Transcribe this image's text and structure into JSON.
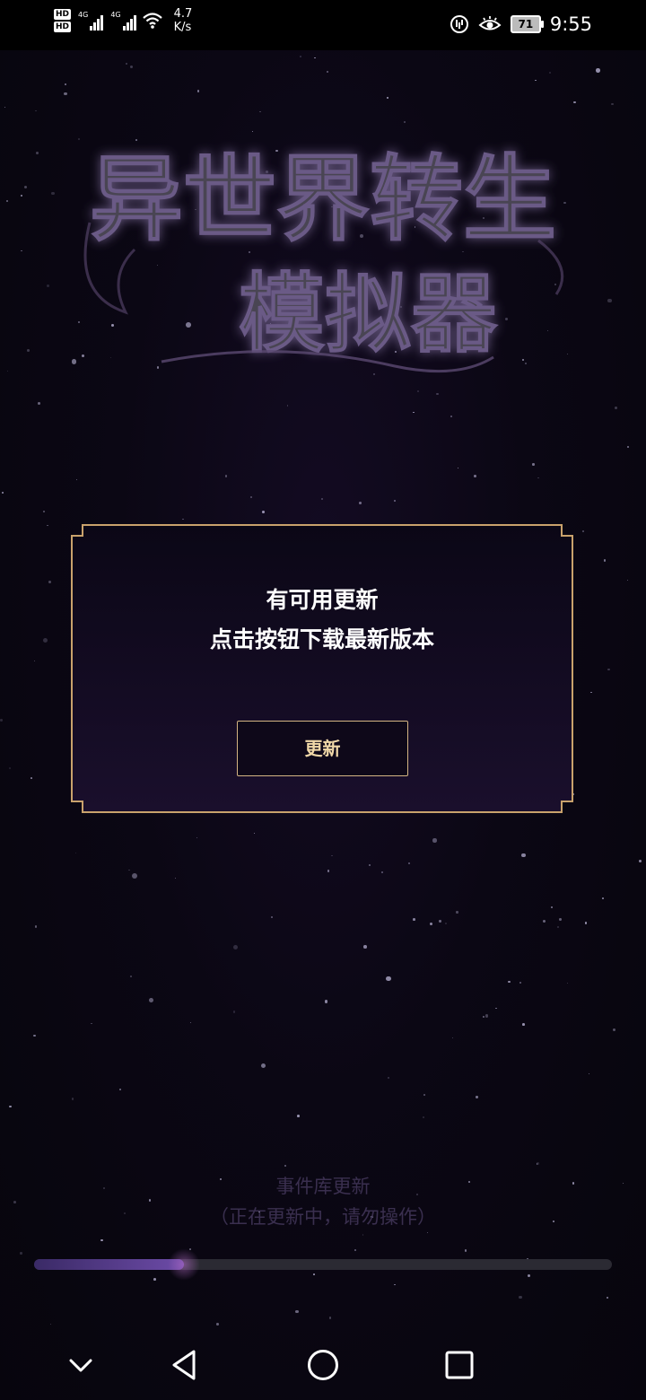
{
  "status_bar": {
    "hd1": "HD",
    "hd2": "HD",
    "sim1": "4G",
    "sim2": "4G",
    "speed_value": "4.7",
    "speed_unit": "K/s",
    "battery": "71",
    "time": "9:55"
  },
  "logo": {
    "line1": "异世界转生",
    "line2": "模拟器"
  },
  "dialog": {
    "title": "有可用更新",
    "message": "点击按钮下载最新版本",
    "button_label": "更新"
  },
  "progress": {
    "label": "事件库更新",
    "note": "（正在更新中，请勿操作）",
    "fraction": 0.26
  },
  "colors": {
    "accent_gold": "#d4b583",
    "progress_fill": "#6d4ba8",
    "background": "#0b0714"
  },
  "icons": {
    "nav": [
      "chevron-down-icon",
      "back-icon",
      "home-icon",
      "recents-icon"
    ]
  }
}
